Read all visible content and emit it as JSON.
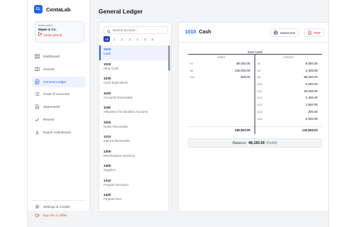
{
  "app": {
    "logo_initials": "CL",
    "name": "ContaLab"
  },
  "period": {
    "label": "Active period",
    "name": "Maple & Co.",
    "close_label": "Close period"
  },
  "nav": [
    {
      "label": "Dashboard",
      "icon": "grid-icon",
      "active": false
    },
    {
      "label": "Journal",
      "icon": "book-icon",
      "active": false
    },
    {
      "label": "General Ledger",
      "icon": "ledger-icon",
      "active": true
    },
    {
      "label": "Chart of Accounts",
      "icon": "list-icon",
      "active": false
    },
    {
      "label": "Statements",
      "icon": "document-icon",
      "active": false
    },
    {
      "label": "Review",
      "icon": "check-icon",
      "active": false
    },
    {
      "label": "Export Submission",
      "icon": "download-icon",
      "active": false
    }
  ],
  "footer": {
    "settings_label": "Settings & Credits",
    "coffee_label": "Buy me a coffee"
  },
  "page_title": "General Ledger",
  "accounts": {
    "search_placeholder": "Search account...",
    "pages": [
      "All",
      "1",
      "2",
      "3",
      "4",
      "5",
      "6"
    ],
    "active_page": "All",
    "items": [
      {
        "code": "1010",
        "name": "Cash",
        "active": true
      },
      {
        "code": "1020",
        "name": "Petty Cash",
        "active": false
      },
      {
        "code": "1030",
        "name": "Cash Equivalents",
        "active": false
      },
      {
        "code": "1100",
        "name": "Accounts Receivable",
        "active": false
      },
      {
        "code": "1150",
        "name": "Allowance for Doubtful Accounts",
        "active": false
      },
      {
        "code": "1200",
        "name": "Notes Receivable",
        "active": false
      },
      {
        "code": "1210",
        "name": "Interest Receivable",
        "active": false
      },
      {
        "code": "1300",
        "name": "Merchandise Inventory",
        "active": false
      },
      {
        "code": "1400",
        "name": "Supplies",
        "active": false
      },
      {
        "code": "1410",
        "name": "Prepaid Insurance",
        "active": false
      },
      {
        "code": "1420",
        "name": "Prepaid Rent",
        "active": false
      }
    ]
  },
  "ledger": {
    "account_code": "1010",
    "account_name": "Cash",
    "statement_label": "Statement",
    "pdf_label": "PDF",
    "t_title": "1010 Cash",
    "debit_label": "DEBIT",
    "credit_label": "CREDIT",
    "debits": [
      {
        "ref": "#1",
        "amount": "80,000.00"
      },
      {
        "ref": "#6",
        "amount": "100,000.00"
      },
      {
        "ref": "#14",
        "amount": "500.00"
      }
    ],
    "credits": [
      {
        "ref": "#2",
        "amount": "9,000.00"
      },
      {
        "ref": "#3",
        "amount": "2,400.00"
      },
      {
        "ref": "#9",
        "amount": "85,000.00"
      },
      {
        "ref": "#10",
        "amount": "6,000.00"
      },
      {
        "ref": "#11",
        "amount": "20,000.00"
      },
      {
        "ref": "#12",
        "amount": "2,400.00"
      },
      {
        "ref": "#13",
        "amount": "1,600.00"
      },
      {
        "ref": "#15",
        "amount": "200.00"
      },
      {
        "ref": "#16",
        "amount": "5,000.00"
      }
    ],
    "debit_total": "180,500.00",
    "credit_total": "132,500.00",
    "balance_label": "Balance:",
    "balance_amount": "48,100.00",
    "balance_side": "(Debit)"
  },
  "colors": {
    "accent": "#2563eb",
    "danger": "#dc2626",
    "coffee": "#ea580c"
  }
}
